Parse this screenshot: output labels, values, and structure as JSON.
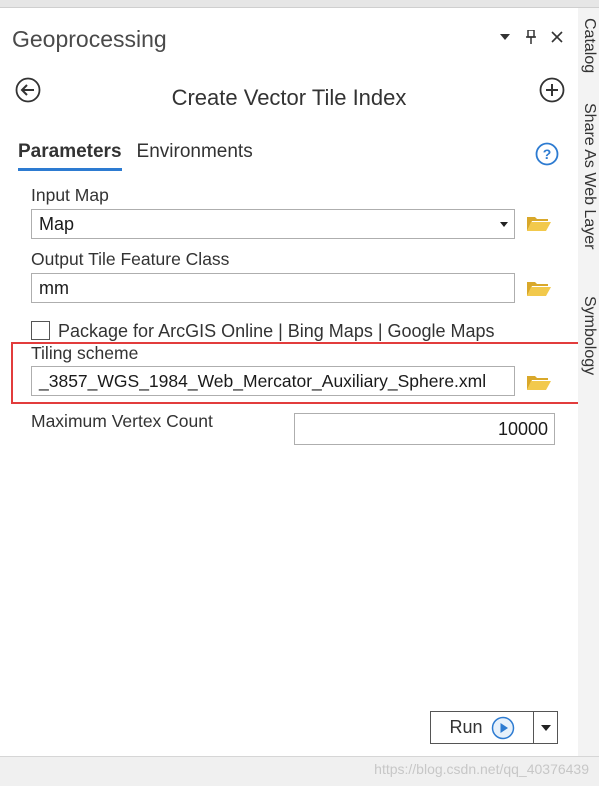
{
  "pane": {
    "title": "Geoprocessing",
    "tool_title": "Create Vector Tile Index"
  },
  "tabs": [
    {
      "label": "Parameters",
      "active": true
    },
    {
      "label": "Environments",
      "active": false
    }
  ],
  "params": {
    "input_map": {
      "label": "Input Map",
      "value": "Map"
    },
    "output_fc": {
      "label": "Output Tile Feature Class",
      "value": "mm"
    },
    "package": {
      "label": "Package for ArcGIS Online | Bing Maps | Google Maps",
      "checked": false
    },
    "tiling_scheme": {
      "label": "Tiling scheme",
      "value": "_3857_WGS_1984_Web_Mercator_Auxiliary_Sphere.xml"
    },
    "max_vertex": {
      "label": "Maximum Vertex Count",
      "value": "10000"
    }
  },
  "run": {
    "label": "Run"
  },
  "side_tabs": [
    "Catalog",
    "Share As Web Layer",
    "Symbology"
  ],
  "watermark": "https://blog.csdn.net/qq_40376439",
  "colors": {
    "accent": "#2d7bd1",
    "highlight": "#e23c3c",
    "folder": "#e8b93b"
  },
  "icons": [
    "back-arrow-icon",
    "add-circle-icon",
    "help-icon",
    "folder-icon",
    "run-play-icon",
    "pin-icon",
    "close-icon",
    "chevron-down-icon"
  ]
}
